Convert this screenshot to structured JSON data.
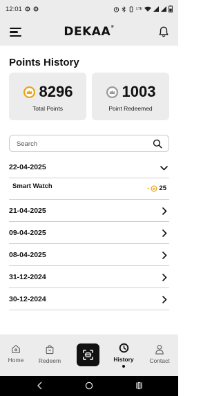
{
  "status_bar": {
    "time": "12:01",
    "lte_label": "LTE"
  },
  "header": {
    "logo": "DEKAA",
    "logo_mark": "®"
  },
  "page": {
    "title": "Points History"
  },
  "stats": {
    "total_points": "8296",
    "total_label": "Total Points",
    "redeemed_points": "1003",
    "redeemed_label": "Point Redeemed",
    "gold_color": "#e8a51a",
    "silver_color": "#9a9a9a"
  },
  "search": {
    "placeholder": "Search",
    "value": ""
  },
  "history": [
    {
      "date": "22-04-2025",
      "expanded": true,
      "items": [
        {
          "name": "Smart Watch",
          "sign": "-",
          "points": "25"
        }
      ]
    },
    {
      "date": "21-04-2025",
      "expanded": false
    },
    {
      "date": "09-04-2025",
      "expanded": false
    },
    {
      "date": "08-04-2025",
      "expanded": false
    },
    {
      "date": "31-12-2024",
      "expanded": false
    },
    {
      "date": "30-12-2024",
      "expanded": false
    }
  ],
  "nav": {
    "home": "Home",
    "redeem": "Redeem",
    "scan_icon": "scan-icon",
    "history": "History",
    "contact": "Contact",
    "active": "History"
  }
}
